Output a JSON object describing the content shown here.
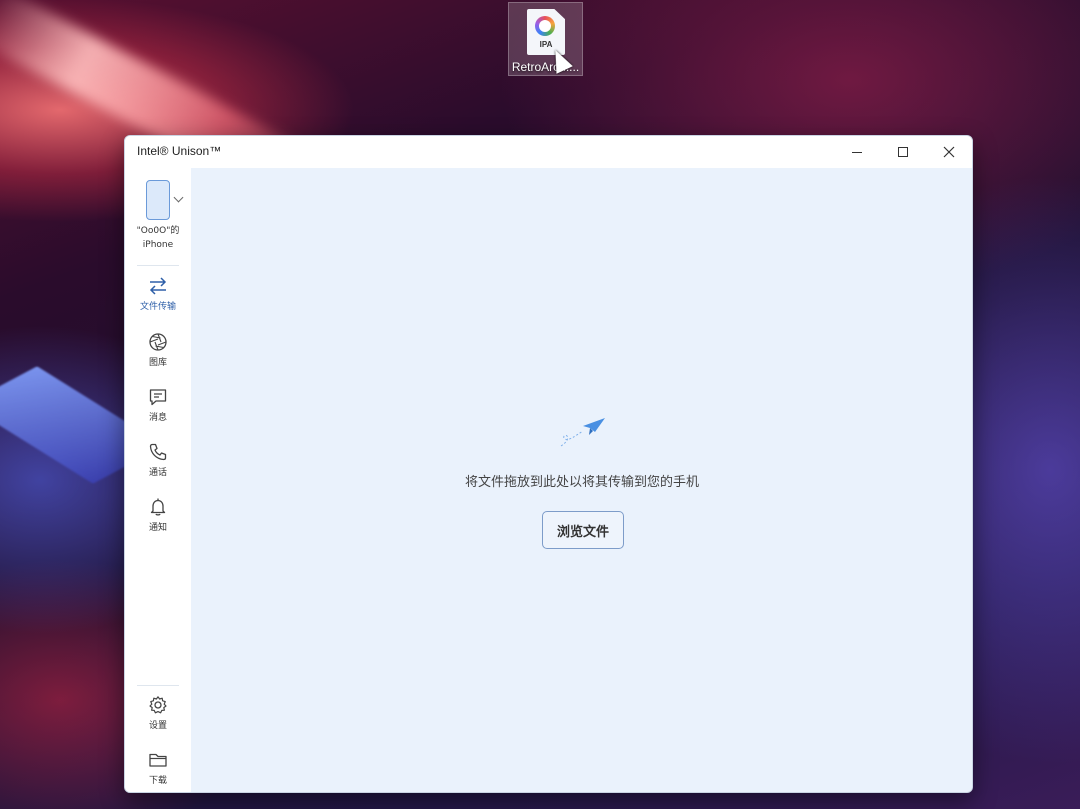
{
  "desktop": {
    "icon": {
      "badge": "IPA",
      "label": "RetroArch...."
    }
  },
  "window": {
    "title": "Intel® Unison™",
    "controls": {
      "minimize": "minimize-icon",
      "maximize": "maximize-icon",
      "close": "close-icon"
    }
  },
  "sidebar": {
    "device": {
      "line1": "\"Oo0O\"的",
      "line2": "iPhone"
    },
    "items": [
      {
        "label": "文件传输",
        "icon": "transfer-arrows-icon",
        "active": true
      },
      {
        "label": "图库",
        "icon": "aperture-icon"
      },
      {
        "label": "消息",
        "icon": "message-icon"
      },
      {
        "label": "通话",
        "icon": "phone-icon"
      },
      {
        "label": "通知",
        "icon": "bell-icon"
      }
    ],
    "bottom_items": [
      {
        "label": "设置",
        "icon": "gear-icon"
      },
      {
        "label": "下载",
        "icon": "folder-icon"
      }
    ]
  },
  "main": {
    "drop_text": "将文件拖放到此处以将其传输到您的手机",
    "browse_button": "浏览文件"
  },
  "colors": {
    "accent": "#2e5fa8",
    "main_bg": "#eaf2fc",
    "plane": "#4a90e2"
  }
}
